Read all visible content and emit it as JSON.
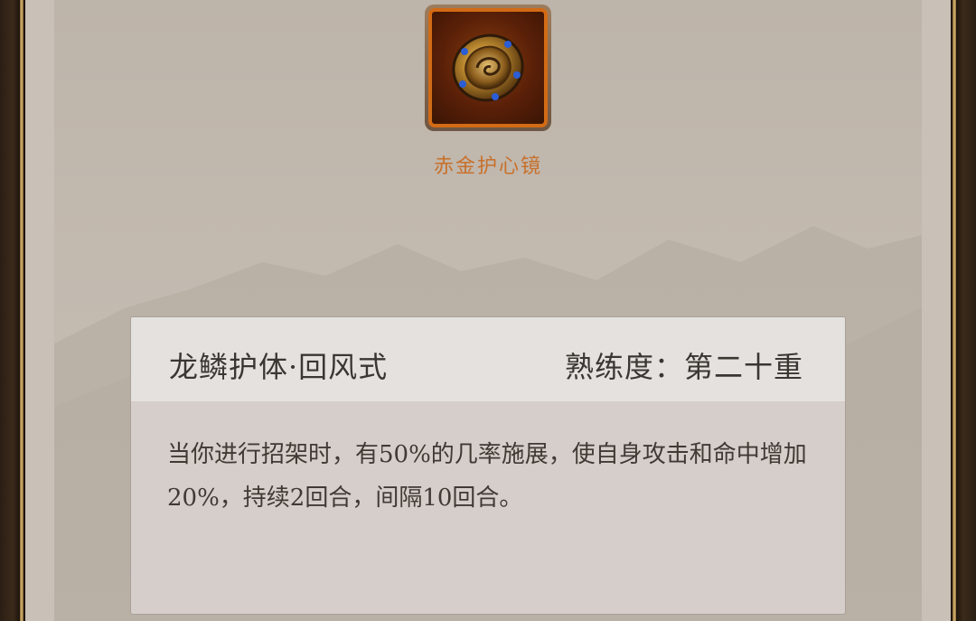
{
  "item": {
    "name": "赤金护心镜",
    "icon": "gold-heart-mirror-icon",
    "border_color": "#d26b16"
  },
  "skill": {
    "name": "龙鳞护体·回风式",
    "proficiency_label": "熟练度：",
    "proficiency_value": "第二十重",
    "description": "当你进行招架时，有50%的几率施展，使自身攻击和命中增加20%，持续2回合，间隔10回合。"
  },
  "colors": {
    "item_name": "#c8702a",
    "text": "#3a3632",
    "card_header": "#e5e1de",
    "card_body": "#d5ceca"
  }
}
